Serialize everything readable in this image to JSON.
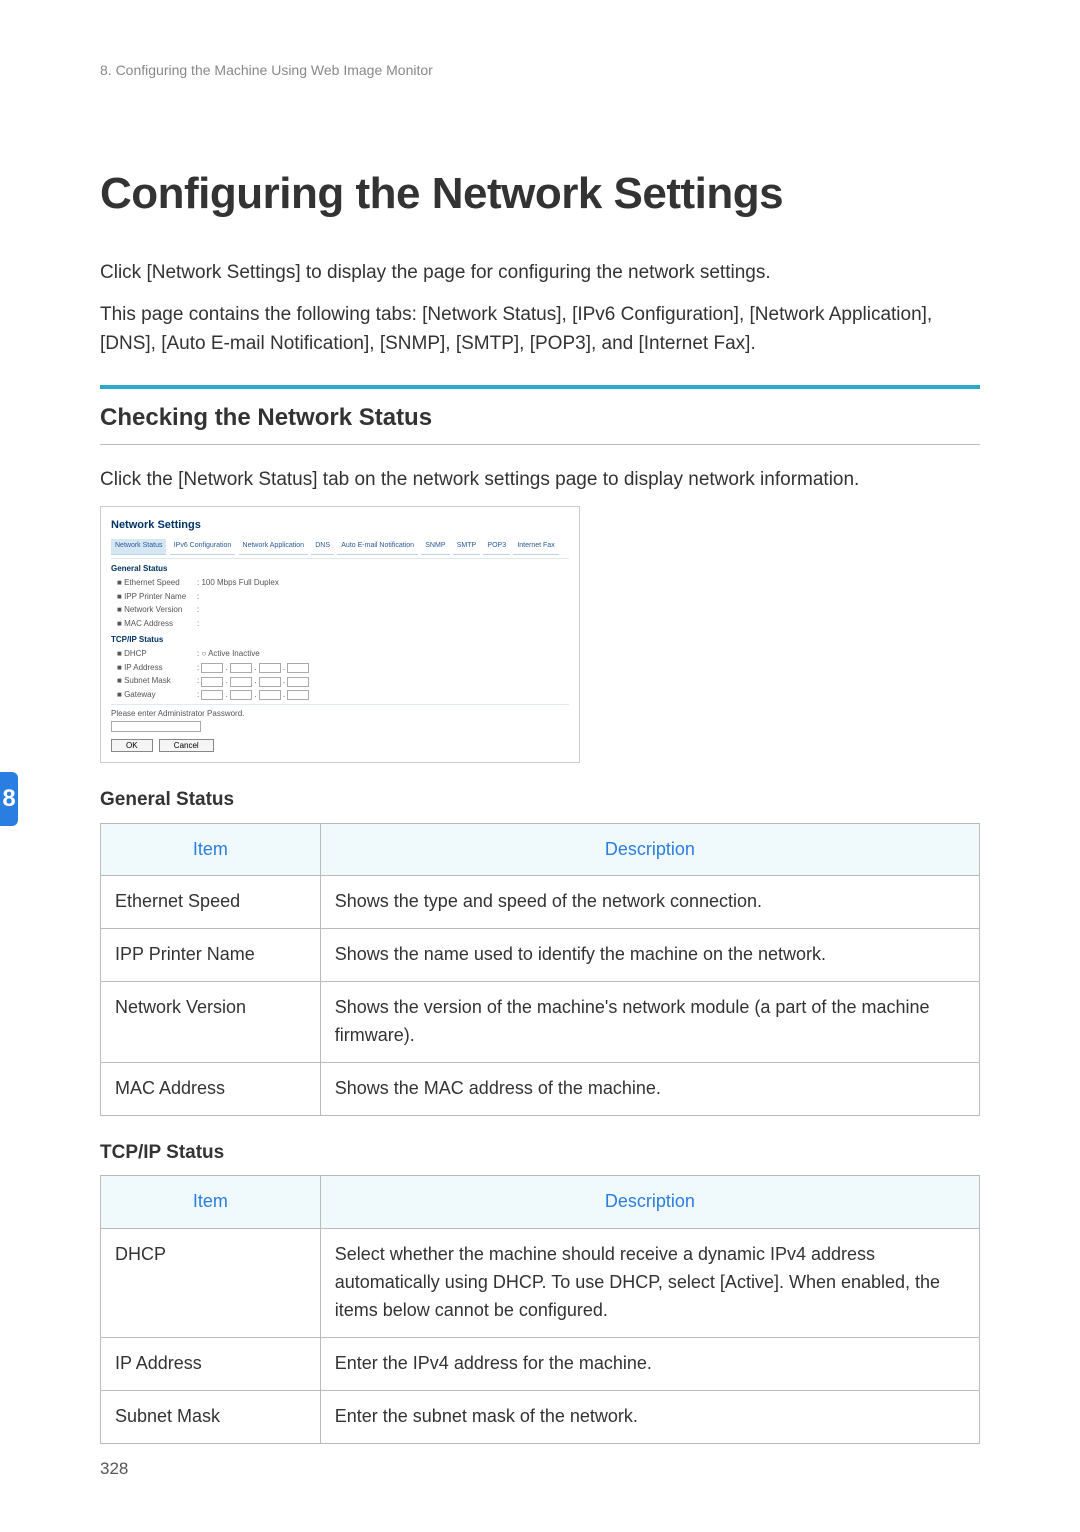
{
  "header": "8. Configuring the Machine Using Web Image Monitor",
  "side_tab": "8",
  "h1": "Configuring the Network Settings",
  "intro1": "Click [Network Settings] to display the page for configuring the network settings.",
  "intro2": "This page contains the following tabs: [Network Status], [IPv6 Configuration], [Network Application], [DNS], [Auto E-mail Notification], [SNMP], [SMTP], [POP3], and [Internet Fax].",
  "section1": "Checking the Network Status",
  "section1_intro": "Click the [Network Status] tab on the network settings page to display network information.",
  "shot": {
    "title": "Network Settings",
    "tabs": [
      "Network Status",
      "IPv6 Configuration",
      "Network Application",
      "DNS",
      "Auto E-mail Notification",
      "SNMP",
      "SMTP",
      "POP3",
      "Internet Fax"
    ],
    "group1": "General Status",
    "g1_rows": [
      {
        "label": "Ethernet Speed",
        "val": ": 100 Mbps Full Duplex"
      },
      {
        "label": "IPP Printer Name",
        "val": ":"
      },
      {
        "label": "Network Version",
        "val": ":"
      },
      {
        "label": "MAC Address",
        "val": ":"
      }
    ],
    "group2": "TCP/IP Status",
    "g2_dhcp_label": "DHCP",
    "g2_dhcp_opts": "Active   Inactive",
    "g2_rows": [
      "IP Address",
      "Subnet Mask",
      "Gateway"
    ],
    "pw": "Please enter Administrator Password.",
    "ok": "OK",
    "cancel": "Cancel"
  },
  "tbl1_head": "General Status",
  "colItem": "Item",
  "colDesc": "Description",
  "tbl1": [
    {
      "item": "Ethernet Speed",
      "desc": "Shows the type and speed of the network connection."
    },
    {
      "item": "IPP Printer Name",
      "desc": "Shows the name used to identify the machine on the network."
    },
    {
      "item": "Network Version",
      "desc": "Shows the version of the machine's network module (a part of the machine firmware)."
    },
    {
      "item": "MAC Address",
      "desc": "Shows the MAC address of the machine."
    }
  ],
  "tbl2_head": "TCP/IP Status",
  "tbl2": [
    {
      "item": "DHCP",
      "desc": "Select whether the machine should receive a dynamic IPv4 address automatically using DHCP. To use DHCP, select [Active]. When enabled, the items below cannot be configured."
    },
    {
      "item": "IP Address",
      "desc": "Enter the IPv4 address for the machine."
    },
    {
      "item": "Subnet Mask",
      "desc": "Enter the subnet mask of the network."
    }
  ],
  "page_num": "328"
}
